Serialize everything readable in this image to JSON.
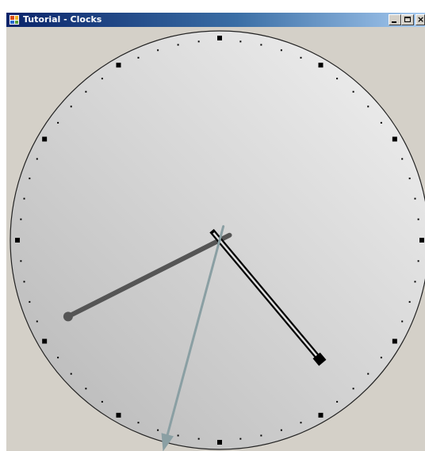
{
  "window": {
    "title": "Tutorial - Clocks",
    "controls": [
      "minimize",
      "maximize",
      "close"
    ],
    "icon": "app-window-icon"
  },
  "clock": {
    "time": {
      "hours": 4,
      "minutes": 40,
      "seconds": 32.5
    },
    "hour_markers": 12,
    "minute_ticks": 60,
    "hands": [
      {
        "name": "hour",
        "style": "outlined-with-square-end"
      },
      {
        "name": "minute",
        "style": "gray-with-round-end"
      },
      {
        "name": "second",
        "style": "slate-with-arrow-head"
      }
    ],
    "colors": {
      "window_bg": "#d4d0c8",
      "face_light": "#f2f2f2",
      "face_dark": "#b6b6b6",
      "marks": "#000000",
      "hour_hand": "#000000",
      "minute_hand": "#555555",
      "second_hand": "#8a9fa3"
    }
  }
}
